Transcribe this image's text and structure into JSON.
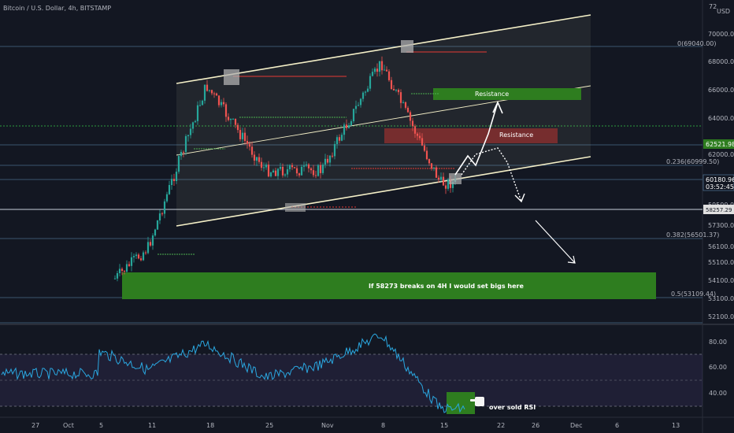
{
  "header": {
    "title": "Bitcoin / U.S. Dollar, 4h, BITSTAMP"
  },
  "price_axis": {
    "currency": "USD",
    "top_label": "72",
    "ticks": [
      "70000.00",
      "68000.00",
      "66000.00",
      "64000.00",
      "62000.00",
      "59500.00",
      "57300.00",
      "56100.00",
      "55100.00",
      "54100.00",
      "53100.00",
      "52100.00"
    ],
    "current_price": "60180.96",
    "countdown": "03:52:45",
    "badge_upper": "62521.98",
    "badge_level": "58257.29"
  },
  "rsi_axis": {
    "ticks": [
      "80.00",
      "60.00",
      "40.00"
    ]
  },
  "time_axis": {
    "ticks": [
      "27",
      "Oct",
      "5",
      "11",
      "18",
      "25",
      "Nov",
      "8",
      "15",
      "22",
      "26",
      "Dec",
      "6",
      "13"
    ]
  },
  "fib_levels": [
    {
      "label": "0(69040.00)"
    },
    {
      "label": "0.236(60999.50)"
    },
    {
      "label": "0.382(56501.37)"
    },
    {
      "label": "0.5(53109.44)"
    }
  ],
  "annotations": {
    "resistance_upper": "Resistance",
    "resistance_lower": "Resistance",
    "buy_zone": "If 58273 breaks on 4H I would set bigs here",
    "rsi_note": "over sold RSI"
  },
  "colors": {
    "background": "#131722",
    "candle_up": "#26a69a",
    "candle_down": "#ef5350",
    "channel": "#f5f0c8",
    "zone_green": "#2e7d1f",
    "zone_red": "#7f2f2f",
    "rsi_line": "#2aa7e0"
  },
  "chart_data": {
    "type": "line",
    "symbol": "Bitcoin / U.S. Dollar",
    "interval": "4h",
    "exchange": "BITSTAMP",
    "x": [
      "27",
      "Oct",
      "5",
      "11",
      "18",
      "25",
      "Nov",
      "8",
      "15"
    ],
    "series": [
      {
        "values": [
          null,
          null,
          53000,
          56000,
          66500,
          61000,
          61000,
          68000,
          60180.96
        ]
      }
    ],
    "ylim": [
      51500,
      72000
    ],
    "rsi": {
      "ylim": [
        20,
        95
      ],
      "levels": [
        70,
        50,
        30
      ],
      "x": [
        "27",
        "Oct",
        "5",
        "11",
        "18",
        "25",
        "Nov",
        "8",
        "15"
      ],
      "values": [
        null,
        null,
        72,
        58,
        78,
        52,
        62,
        85,
        28
      ]
    }
  }
}
